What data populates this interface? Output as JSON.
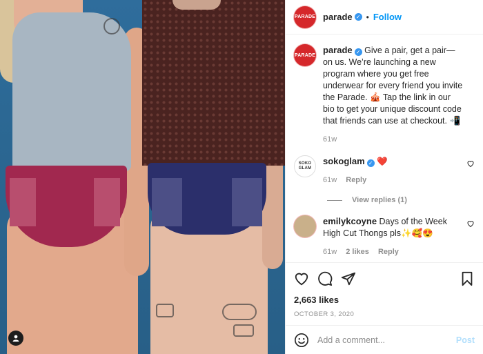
{
  "post": {
    "author": {
      "username": "parade",
      "avatar_text": "PARADE",
      "verified": true
    },
    "follow_label": "Follow",
    "caption": "Give a pair, get a pair—on us. We’re launching a new program where you get free underwear for every friend you invite the Parade. 🎪 Tap the link in our bio to get your unique discount code that friends can use at checkout. 📲",
    "caption_time": "61w",
    "likes": "2,663 likes",
    "date": "OCTOBER 3, 2020"
  },
  "comments": [
    {
      "username": "sokoglam",
      "avatar_text": "SOKO GLAM",
      "verified": true,
      "text": "❤️",
      "time": "61w",
      "likes": "",
      "reply_label": "Reply",
      "view_replies": "View replies (1)"
    },
    {
      "username": "emilykcoyne",
      "verified": false,
      "text": "Days of the Week High Cut Thongs pls✨🥰😍",
      "time": "61w",
      "likes": "2 likes",
      "reply_label": "Reply"
    }
  ],
  "add_comment": {
    "placeholder": "Add a comment...",
    "post_label": "Post"
  },
  "icons": {
    "like": "heart-icon",
    "comment": "comment-icon",
    "share": "share-icon",
    "save": "bookmark-icon",
    "emoji": "emoji-icon",
    "tag": "user-tag-icon"
  },
  "colors": {
    "brand": "#d5282b",
    "link": "#0095f6",
    "muted": "#8e8e8e",
    "verified": "#3897f0"
  }
}
